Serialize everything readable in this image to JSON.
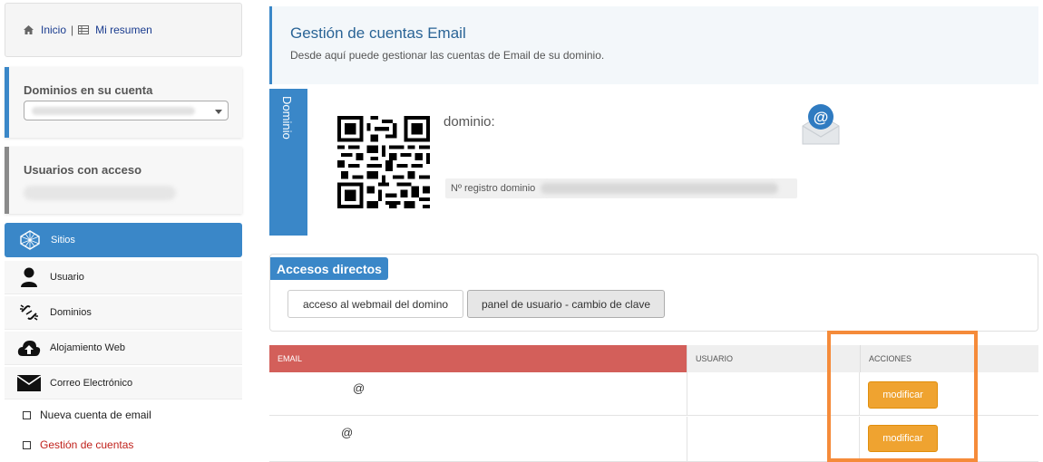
{
  "breadcrumb": {
    "home": "Inicio",
    "separator": "|",
    "summary": "Mi resumen"
  },
  "sidebar": {
    "domains_title": "Dominios en su cuenta",
    "users_title": "Usuarios con acceso",
    "nav": [
      {
        "label": "Sitios",
        "icon": "globe-icon",
        "active": true
      },
      {
        "label": "Usuario",
        "icon": "user-icon"
      },
      {
        "label": "Dominios",
        "icon": "broken-link-icon"
      },
      {
        "label": "Alojamiento Web",
        "icon": "cloud-upload-icon"
      },
      {
        "label": "Correo Electrónico",
        "icon": "envelope-icon"
      }
    ],
    "sub_items": [
      {
        "label": "Nueva cuenta de email"
      },
      {
        "label": "Gestión de cuentas",
        "active": true
      }
    ]
  },
  "header": {
    "title": "Gestión de cuentas Email",
    "subtitle": "Desde aquí puede gestionar las cuentas de Email de su dominio."
  },
  "domain": {
    "tab_label": "Dominio",
    "label": "dominio:",
    "registry_label": "Nº registro dominio"
  },
  "shortcuts": {
    "title": "Accesos directos",
    "buttons": [
      "acceso al webmail del domino",
      "panel de usuario - cambio de clave"
    ]
  },
  "table": {
    "headers": [
      "EMAIL",
      "USUARIO",
      "ACCIONES"
    ],
    "rows": [
      {
        "email": "@",
        "action": "modificar"
      },
      {
        "email": "@",
        "action": "modificar"
      }
    ]
  },
  "colors": {
    "accent": "#3a87c8",
    "email_header": "#d35f5a",
    "action_button": "#efa330",
    "highlight": "#f58b3a"
  }
}
